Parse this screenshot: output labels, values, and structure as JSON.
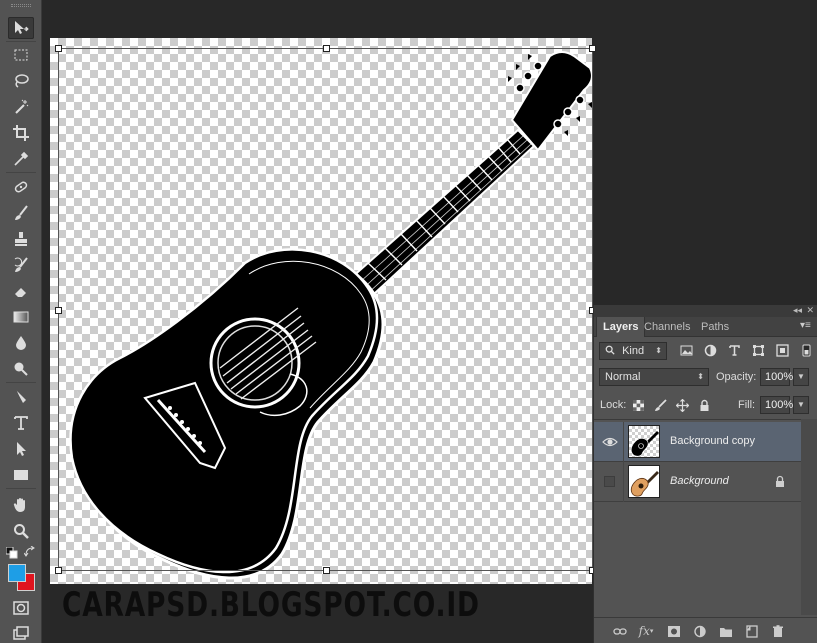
{
  "toolbar": {
    "tools": [
      {
        "name": "move-tool",
        "icon": "move-icon",
        "active": true
      },
      {
        "name": "marquee-tool",
        "icon": "marquee-icon"
      },
      {
        "name": "lasso-tool",
        "icon": "lasso-icon"
      },
      {
        "name": "magic-wand-tool",
        "icon": "magic-wand-icon"
      },
      {
        "name": "crop-tool",
        "icon": "crop-icon"
      },
      {
        "name": "eyedropper-tool",
        "icon": "eyedropper-icon"
      },
      {
        "name": "healing-brush-tool",
        "icon": "healing-brush-icon"
      },
      {
        "name": "brush-tool",
        "icon": "brush-icon"
      },
      {
        "name": "clone-stamp-tool",
        "icon": "clone-stamp-icon"
      },
      {
        "name": "history-brush-tool",
        "icon": "history-brush-icon"
      },
      {
        "name": "eraser-tool",
        "icon": "eraser-icon"
      },
      {
        "name": "gradient-tool",
        "icon": "gradient-icon"
      },
      {
        "name": "blur-tool",
        "icon": "blur-icon"
      },
      {
        "name": "dodge-tool",
        "icon": "dodge-icon"
      },
      {
        "name": "pen-tool",
        "icon": "pen-icon"
      },
      {
        "name": "type-tool",
        "icon": "type-icon"
      },
      {
        "name": "path-selection-tool",
        "icon": "path-selection-icon"
      },
      {
        "name": "rectangle-tool",
        "icon": "rectangle-icon"
      },
      {
        "name": "hand-tool",
        "icon": "hand-icon"
      },
      {
        "name": "zoom-tool",
        "icon": "zoom-icon"
      }
    ],
    "foreground_color": "#1e9ee6",
    "background_color": "#e0141e"
  },
  "canvas": {
    "watermark": "CARAPSD.BLOGSPOT.CO.ID"
  },
  "layers_panel": {
    "tabs": [
      {
        "label": "Layers",
        "active": true
      },
      {
        "label": "Channels",
        "active": false
      },
      {
        "label": "Paths",
        "active": false
      }
    ],
    "filter": {
      "kind_label": "Kind"
    },
    "blend_mode": "Normal",
    "opacity_label": "Opacity:",
    "opacity_value": "100%",
    "lock_label": "Lock:",
    "fill_label": "Fill:",
    "fill_value": "100%",
    "layers": [
      {
        "name": "Background copy",
        "visible": true,
        "selected": true,
        "locked": false
      },
      {
        "name": "Background",
        "visible": false,
        "selected": false,
        "locked": true
      }
    ],
    "footer_fx": "fx"
  }
}
